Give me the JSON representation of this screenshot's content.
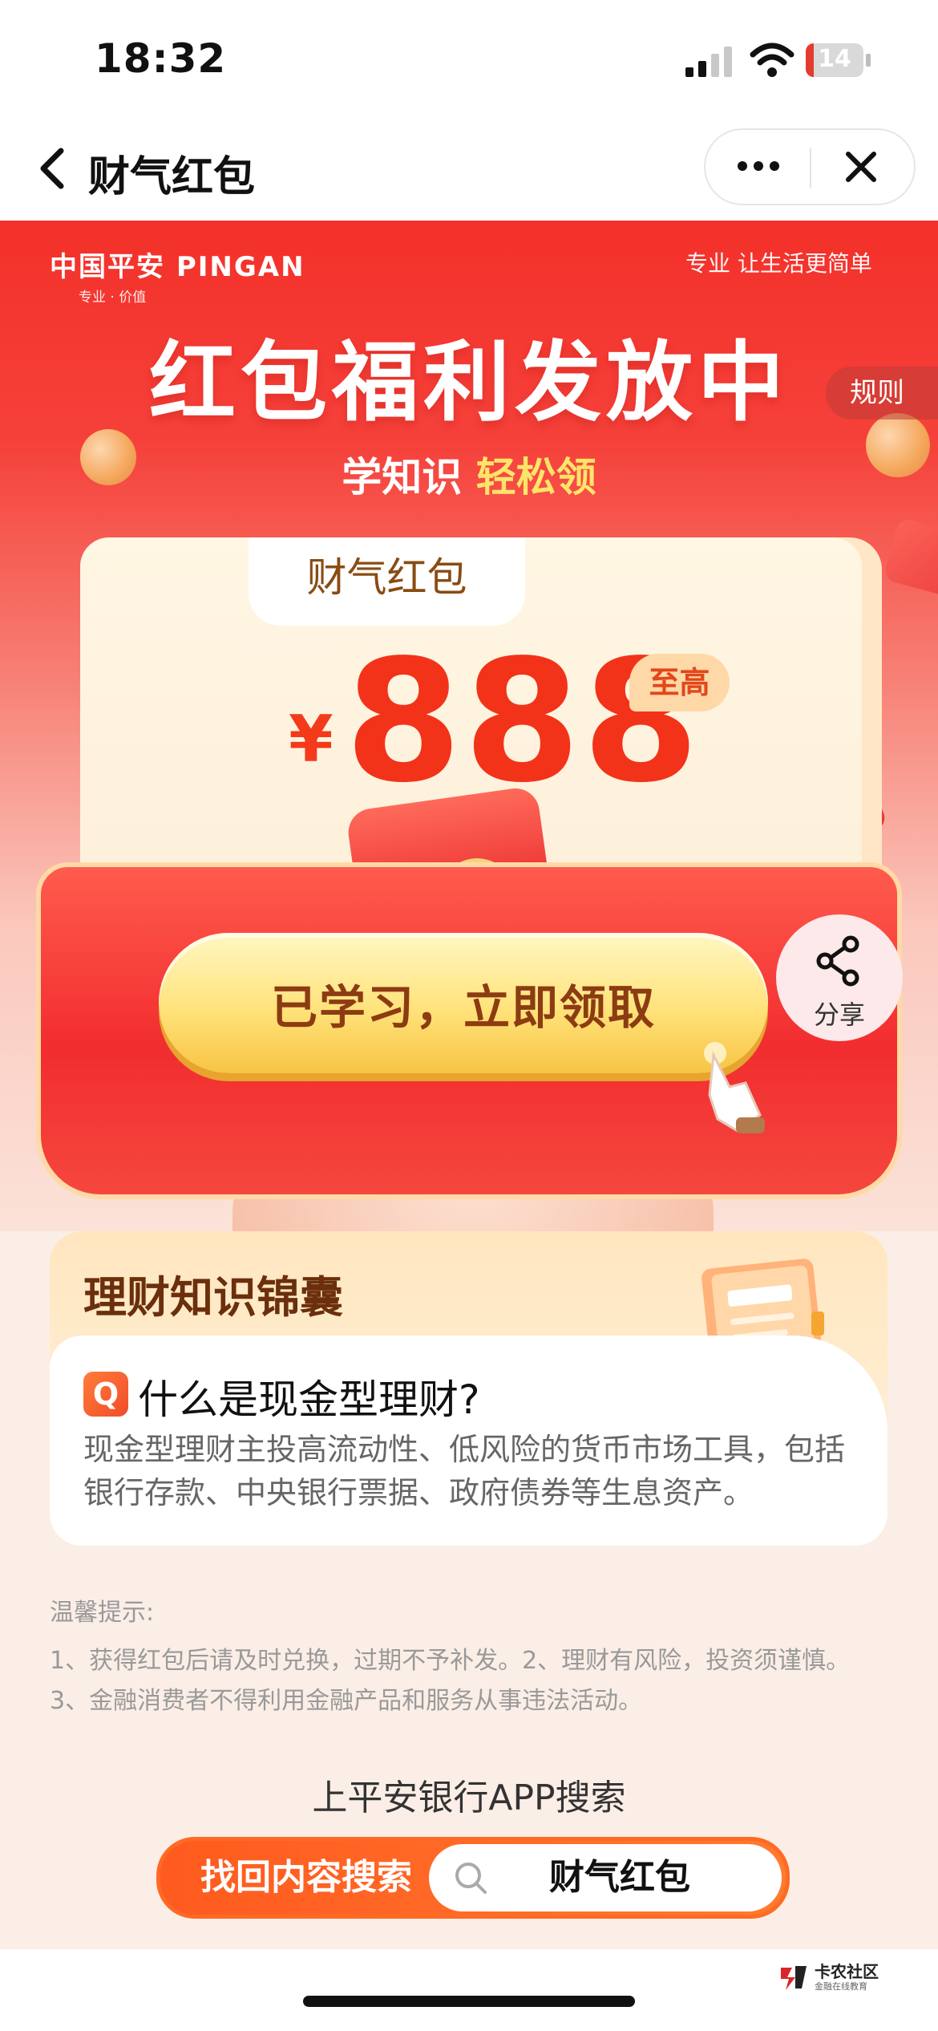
{
  "status_bar": {
    "time": "18:32",
    "battery_level": "14",
    "battery_fraction": 0.14
  },
  "nav": {
    "title": "财气红包"
  },
  "brand": {
    "name": "中国平安 PINGAN",
    "tagline": "专业 · 价值",
    "slogan": "专业 让生活更简单"
  },
  "hero": {
    "title": "红包福利发放中",
    "subtitle_part1": "学知识",
    "subtitle_part2": "轻松领",
    "rules_label": "规则"
  },
  "card": {
    "tab_label": "财气红包",
    "currency_symbol": "¥",
    "amount": "888",
    "max_badge": "至高",
    "seal_char": "¥"
  },
  "cta": {
    "label": "已学习，立即领取"
  },
  "share": {
    "label": "分享"
  },
  "knowledge": {
    "title": "理财知识锦囊",
    "q_badge": "Q",
    "question": "什么是现金型理财?",
    "answer": "现金型理财主投高流动性、低风险的货币市场工具，包括银行存款、中央银行票据、政府债券等生息资产。"
  },
  "tips": {
    "title": "温馨提示:",
    "lines": [
      "1、获得红包后请及时兑换，过期不予补发。2、理财有风险，投资须谨慎。",
      "3、金融消费者不得利用金融产品和服务从事违法活动。"
    ]
  },
  "search": {
    "hint": "上平安银行APP搜索",
    "left_label": "找回内容搜索",
    "keyword": "财气红包"
  },
  "watermark": {
    "name": "卡农社区",
    "sub": "金融在线教育"
  },
  "colors": {
    "hero_red": "#f4302a",
    "cta_gold": "#ffe27a",
    "amount_red": "#f2331a",
    "search_orange": "#ff6a25"
  }
}
